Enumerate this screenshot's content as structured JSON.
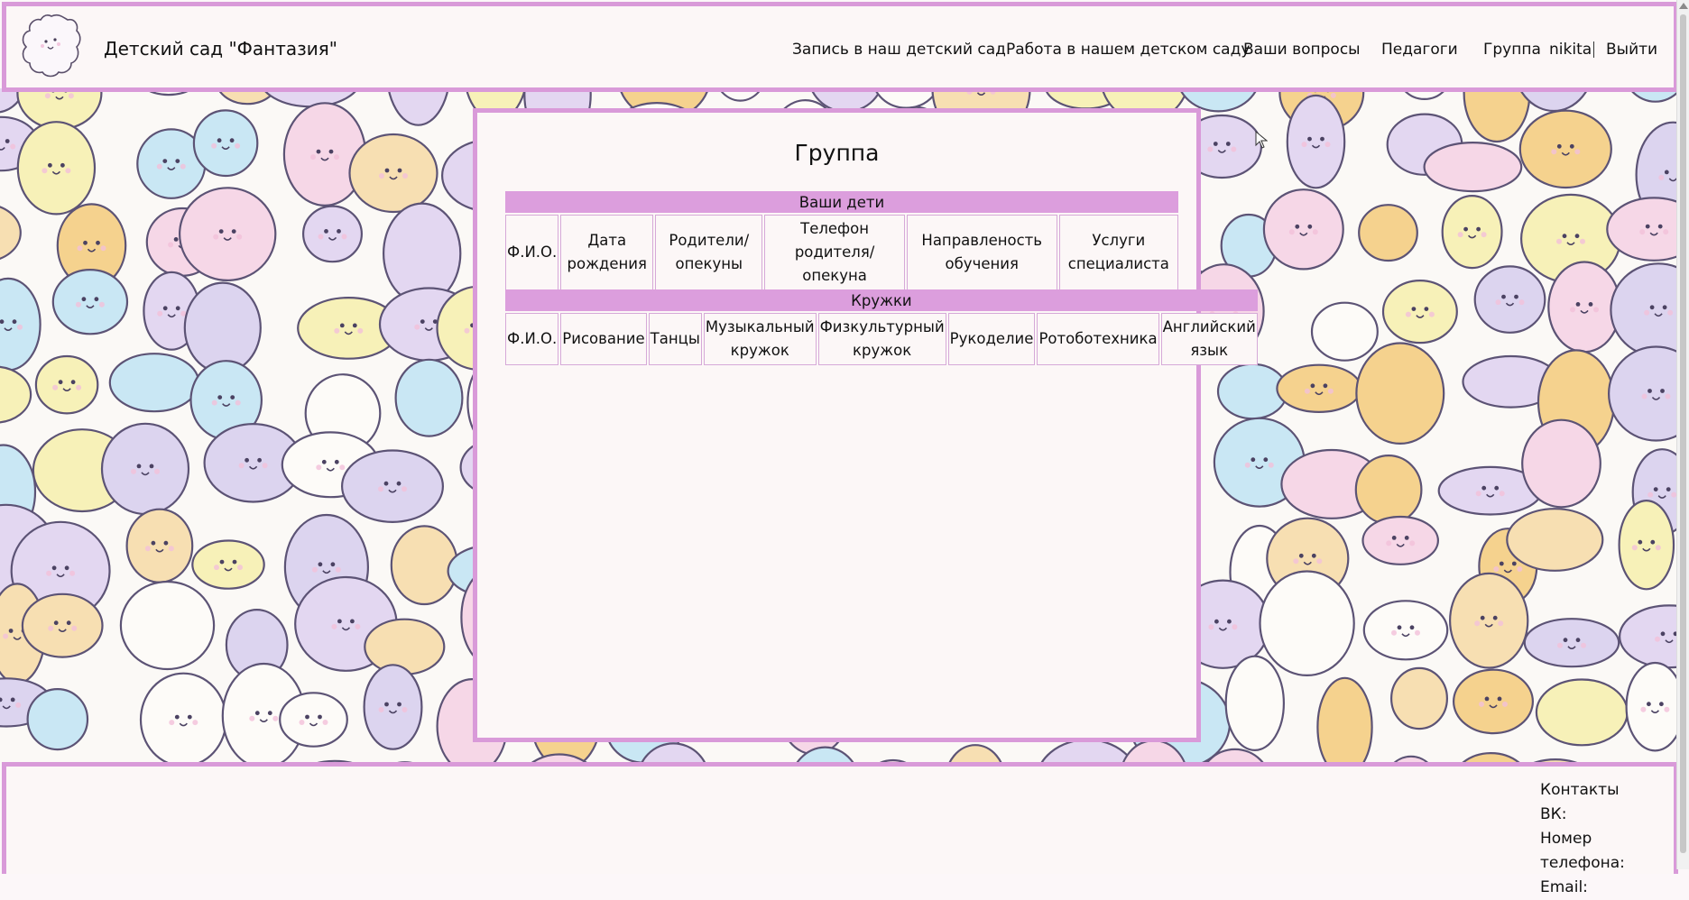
{
  "header": {
    "site_title": "Детский сад \"Фантазия\"",
    "nav": [
      {
        "label": "Запись в наш детский сад"
      },
      {
        "label": "Работа в нашем детском саду"
      },
      {
        "label": "Ваши вопросы"
      },
      {
        "label": "Педагоги"
      },
      {
        "label": "Группа"
      }
    ],
    "username": "nikita",
    "logout": "Выйти"
  },
  "main": {
    "title": "Группа",
    "children_table": {
      "caption": "Ваши дети",
      "columns": [
        "Ф.И.О.",
        "Дата рождения",
        "Родители/ опекуны",
        "Телефон родителя/ опекуна",
        "Направленость обучения",
        "Услуги специалиста"
      ]
    },
    "clubs_table": {
      "caption": "Кружки",
      "columns": [
        "Ф.И.О.",
        "Рисование",
        "Танцы",
        "Музыкальный кружок",
        "Физкультурный кружок",
        "Рукоделие",
        "Ротоботехника",
        "Английский язык"
      ]
    }
  },
  "footer": {
    "contacts_title": "Контакты",
    "vk_label": "ВК:",
    "phone_label": "Номер телефона:",
    "email_label": "Email:"
  },
  "colors": {
    "accent_border": "#d99ad9",
    "table_caption_bg": "#dc9edd",
    "panel_bg": "#fcf7f7"
  }
}
